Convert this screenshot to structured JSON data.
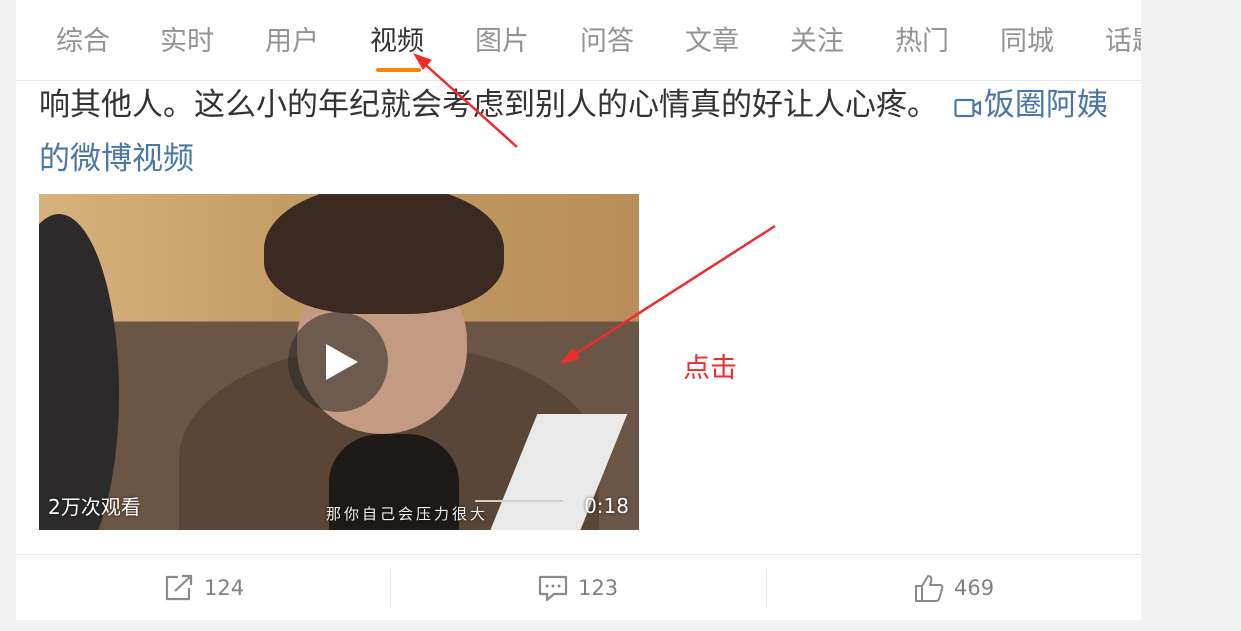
{
  "tabs": [
    {
      "label": "综合"
    },
    {
      "label": "实时"
    },
    {
      "label": "用户"
    },
    {
      "label": "视频"
    },
    {
      "label": "图片"
    },
    {
      "label": "问答"
    },
    {
      "label": "文章"
    },
    {
      "label": "关注"
    },
    {
      "label": "热门"
    },
    {
      "label": "同城"
    },
    {
      "label": "话题"
    }
  ],
  "active_tab": "视频",
  "accent_color": "#ff8200",
  "link_color": "#4a76a8",
  "post": {
    "text": "响其他人。这么小的年纪就会考虑到别人的心情真的好让人心疼。",
    "video_link_icon": "video-camera-icon",
    "video_link_text": "饭圈阿姨的微博视频"
  },
  "video": {
    "views": "2万次观看",
    "duration": "0:18",
    "subtitle": "那你自己会压力很大",
    "play_icon": "play-icon"
  },
  "actions": {
    "share_icon": "share-icon",
    "share_count": "124",
    "comment_icon": "comment-icon",
    "comment_count": "123",
    "like_icon": "thumbs-up-icon",
    "like_count": "469"
  },
  "annotation": {
    "label": "点击",
    "color": "#ef2b2b"
  }
}
